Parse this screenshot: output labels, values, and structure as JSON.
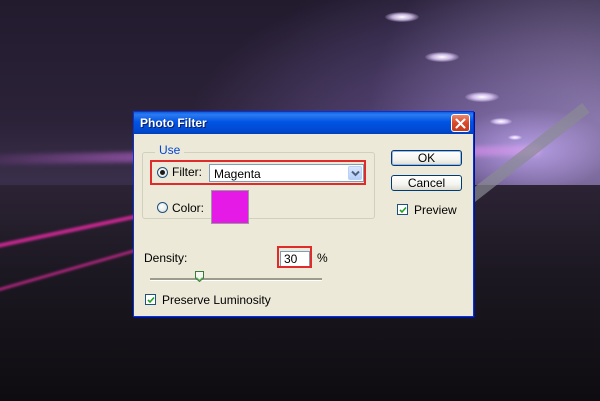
{
  "dialog": {
    "title": "Photo Filter",
    "use_group_label": "Use",
    "filter_label": "Filter:",
    "filter_value": "Magenta",
    "color_label": "Color:",
    "color_swatch": "#e51ae6",
    "selected_option": "filter",
    "ok_label": "OK",
    "cancel_label": "Cancel",
    "preview_label": "Preview",
    "preview_checked": true,
    "density_label": "Density:",
    "density_value": "30",
    "density_unit": "%",
    "preserve_label": "Preserve Luminosity",
    "preserve_checked": true
  },
  "icons": {
    "close": "close-icon",
    "dropdown": "chevron-down-icon",
    "slider": "slider-thumb-icon"
  },
  "colors": {
    "titlebar": "#0054e3",
    "dialog_bg": "#ece9d8",
    "highlight": "#e02b2b",
    "group_label": "#0046d5"
  }
}
